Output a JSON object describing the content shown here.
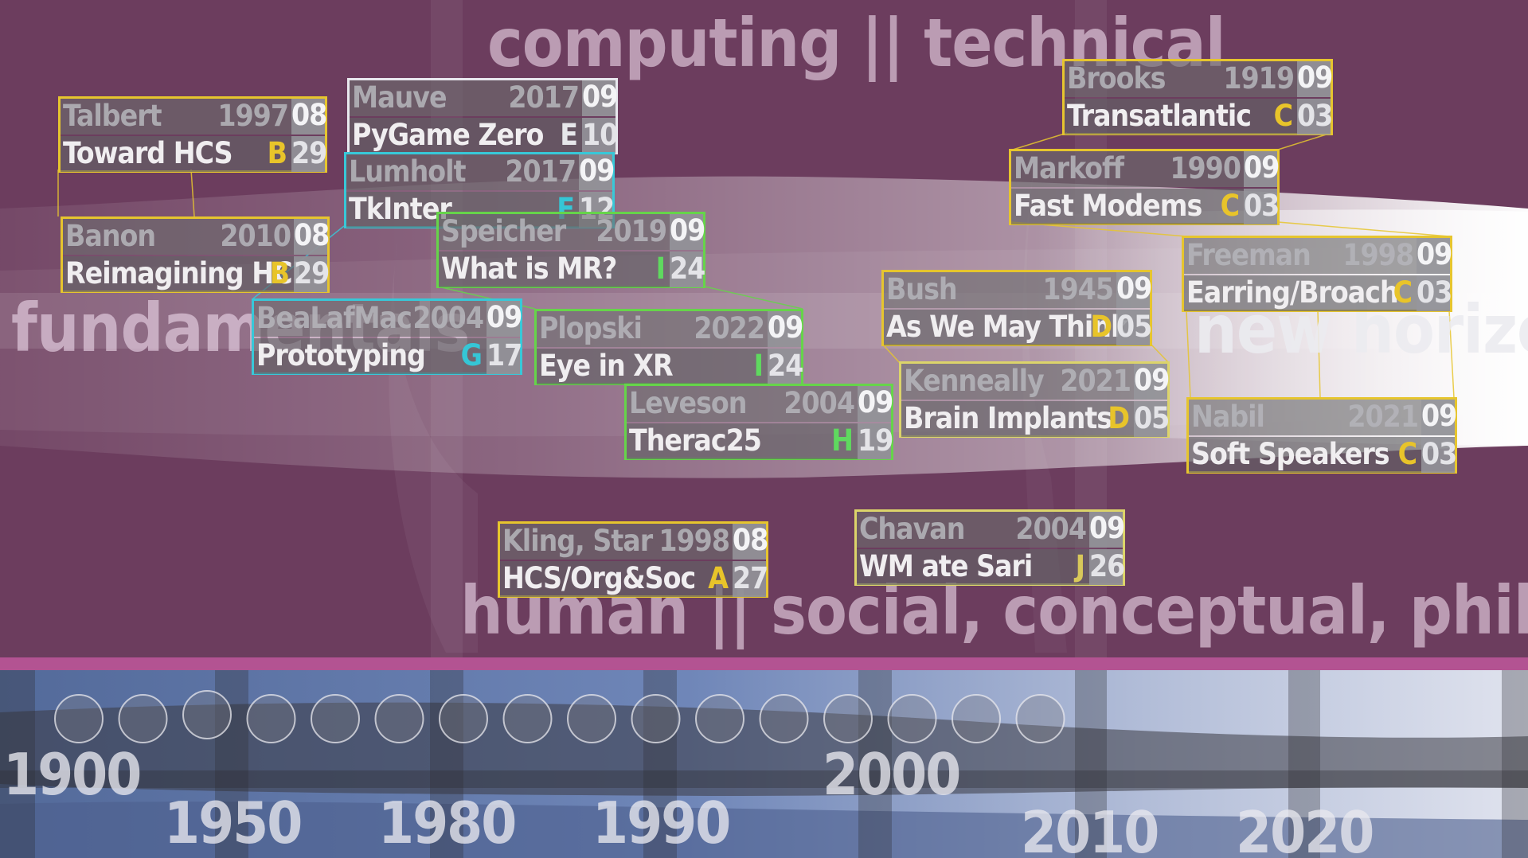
{
  "headings": {
    "top": "computing || technical",
    "left": "fundamentals",
    "right": "new horizons",
    "bottom": "human || social, conceptual, philosophical"
  },
  "timeline": {
    "years": [
      "1900",
      "1950",
      "1980",
      "1990",
      "2000",
      "2010",
      "2020"
    ],
    "circle_count": 16
  },
  "category_colors": {
    "A": "#e8c42a",
    "B": "#e8c42a",
    "C": "#e8c42a",
    "D": "#e8c42a",
    "E": "#e6e6ea",
    "F": "#35c6d6",
    "G": "#35c6d6",
    "H": "#5fd95f",
    "I": "#5fd95f",
    "J": "#d8c85a"
  },
  "border_colors": {
    "yellow": "#e6c52e",
    "white": "#e8e8ee",
    "cyan": "#38c8d8",
    "green": "#66d44a",
    "lightyellow": "#dcd46a"
  },
  "cards": [
    {
      "author": "Talbert",
      "year": "1997",
      "month": "08",
      "title": "Toward HCS",
      "category": "B",
      "week": "29"
    },
    {
      "author": "Banon",
      "year": "2010",
      "month": "08",
      "title": "Reimagining HCI",
      "category": "B",
      "week": "29"
    },
    {
      "author": "Mauve",
      "year": "2017",
      "month": "09",
      "title": "PyGame Zero",
      "category": "E",
      "week": "10"
    },
    {
      "author": "Lumholt",
      "year": "2017",
      "month": "09",
      "title": "TkInter",
      "category": "F",
      "week": "12"
    },
    {
      "author": "Speicher",
      "year": "2019",
      "month": "09",
      "title": "What is MR?",
      "category": "I",
      "week": "24"
    },
    {
      "author": "BeaLafMac",
      "year": "2004",
      "month": "09",
      "title": "Prototyping",
      "category": "G",
      "week": "17"
    },
    {
      "author": "Plopski",
      "year": "2022",
      "month": "09",
      "title": "Eye in XR",
      "category": "I",
      "week": "24"
    },
    {
      "author": "Leveson",
      "year": "2004",
      "month": "09",
      "title": "Therac25",
      "category": "H",
      "week": "19"
    },
    {
      "author": "Kling, Star",
      "year": "1998",
      "month": "08",
      "title": "HCS/Org&Soc",
      "category": "A",
      "week": "27"
    },
    {
      "author": "Brooks",
      "year": "1919",
      "month": "09",
      "title": "Transatlantic",
      "category": "C",
      "week": "03"
    },
    {
      "author": "Markoff",
      "year": "1990",
      "month": "09",
      "title": "Fast Modems",
      "category": "C",
      "week": "03"
    },
    {
      "author": "Freeman",
      "year": "1998",
      "month": "09",
      "title": "Earring/Broach",
      "category": "C",
      "week": "03"
    },
    {
      "author": "Bush",
      "year": "1945",
      "month": "09",
      "title": "As We May Think",
      "category": "D",
      "week": "05"
    },
    {
      "author": "Kenneally",
      "year": "2021",
      "month": "09",
      "title": "Brain Implants",
      "category": "D",
      "week": "05"
    },
    {
      "author": "Nabil",
      "year": "2021",
      "month": "09",
      "title": "Soft Speakers",
      "category": "C",
      "week": "03"
    },
    {
      "author": "Chavan",
      "year": "2004",
      "month": "09",
      "title": "WM ate Sari",
      "category": "J",
      "week": "26"
    }
  ]
}
